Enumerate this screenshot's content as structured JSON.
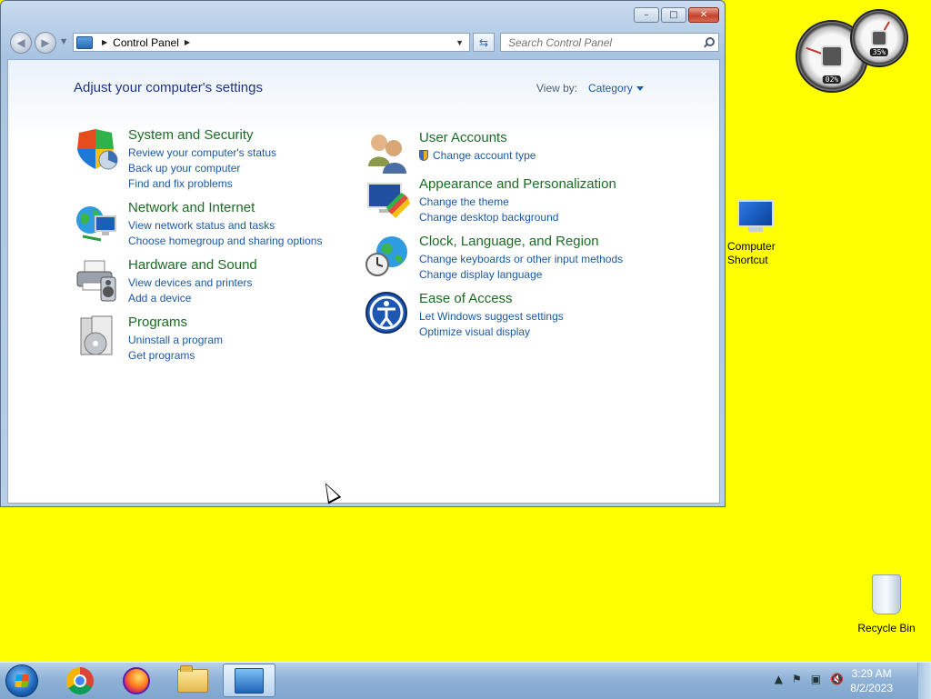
{
  "window": {
    "controls": {
      "minimize": "–",
      "maximize": "□",
      "close": "✕"
    },
    "address": {
      "location": "Control Panel"
    },
    "search": {
      "placeholder": "Search Control Panel"
    },
    "title": "Adjust your computer's settings",
    "view_by": {
      "label": "View by:",
      "value": "Category"
    },
    "categories": [
      {
        "title": "System and Security",
        "icon": "shield-icon",
        "links": [
          "Review your computer's status",
          "Back up your computer",
          "Find and fix problems"
        ]
      },
      {
        "title": "Network and Internet",
        "icon": "network-globe-icon",
        "links": [
          "View network status and tasks",
          "Choose homegroup and sharing options"
        ]
      },
      {
        "title": "Hardware and Sound",
        "icon": "printer-icon",
        "links": [
          "View devices and printers",
          "Add a device"
        ]
      },
      {
        "title": "Programs",
        "icon": "programs-icon",
        "links": [
          "Uninstall a program",
          "Get programs"
        ]
      },
      {
        "title": "User Accounts",
        "icon": "users-icon",
        "links": [
          "Change account type"
        ]
      },
      {
        "title": "Appearance and Personalization",
        "icon": "monitor-palette-icon",
        "links": [
          "Change the theme",
          "Change desktop background"
        ]
      },
      {
        "title": "Clock, Language, and Region",
        "icon": "clock-globe-icon",
        "links": [
          "Change keyboards or other input methods",
          "Change display language"
        ]
      },
      {
        "title": "Ease of Access",
        "icon": "ease-of-access-icon",
        "links": [
          "Let Windows suggest settings",
          "Optimize visual display"
        ]
      }
    ]
  },
  "desktop": {
    "background_color": "#ffff00",
    "gadgets": {
      "cpu_percent": "02%",
      "memory_percent": "35%"
    },
    "icons": [
      {
        "label_line1": "Computer",
        "label_line2": "Shortcut",
        "icon": "computer-icon"
      },
      {
        "label": "Recycle Bin",
        "icon": "recycle-bin-icon"
      }
    ]
  },
  "taskbar": {
    "apps": [
      "Google Chrome",
      "Firefox",
      "File Explorer",
      "Control Panel"
    ],
    "clock": {
      "time": "3:29 AM",
      "date": "8/2/2023"
    }
  }
}
